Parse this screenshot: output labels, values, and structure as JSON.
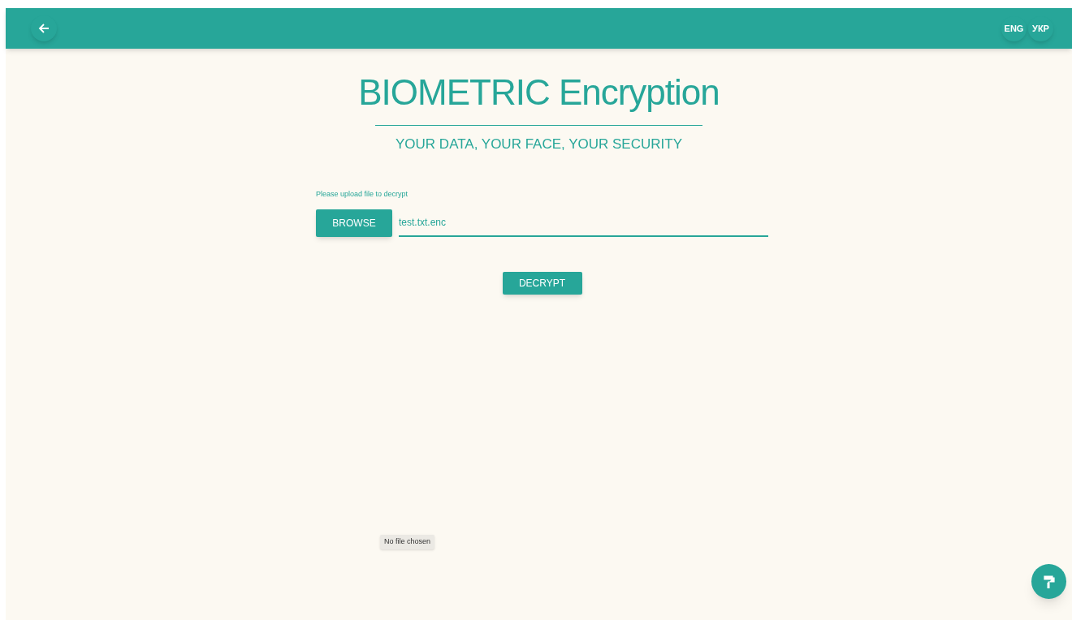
{
  "header": {
    "languages": [
      {
        "label": "ENG"
      },
      {
        "label": "УКР"
      }
    ]
  },
  "title": "BIOMETRIC Encryption",
  "subtitle": "YOUR DATA, YOUR FACE, YOUR SECURITY",
  "form": {
    "label": "Please upload file to decrypt",
    "browse_button": "BROWSE",
    "file_field": {
      "value": "test.txt.enc"
    },
    "decrypt_button": "DECRYPT"
  },
  "file_input_status": "No file chosen"
}
